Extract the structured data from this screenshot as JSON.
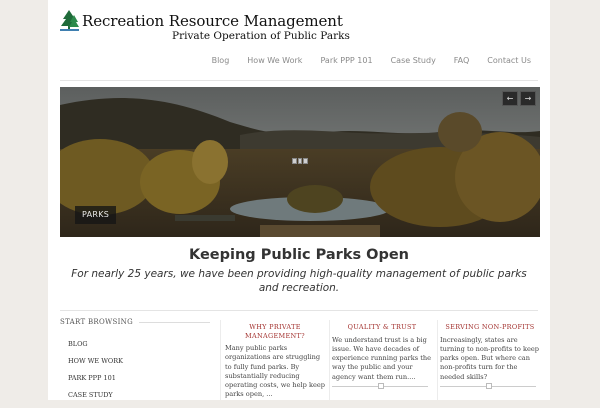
{
  "logo": {
    "title": "Recreation Resource Management",
    "subtitle": "Private Operation of Public Parks",
    "icon": "pine-tree-icon"
  },
  "nav": {
    "items": [
      "Blog",
      "How We Work",
      "Park PPP 101",
      "Case Study",
      "FAQ",
      "Contact Us"
    ]
  },
  "hero": {
    "caption": "PARKS",
    "prev": "←",
    "next": "→"
  },
  "tagline": {
    "title": "Keeping Public Parks Open",
    "text": "For nearly 25 years, we have been providing high-quality management of public parks and recreation."
  },
  "sidebar": {
    "heading": "START BROWSING",
    "items": [
      "BLOG",
      "HOW WE WORK",
      "PARK PPP 101",
      "CASE STUDY"
    ]
  },
  "columns": [
    {
      "title": "WHY PRIVATE MANAGEMENT?",
      "text": "Many public parks organizations are struggling to fully fund parks.  By  substantially reducing operating costs, we help keep parks open, ..."
    },
    {
      "title": "QUALITY & TRUST",
      "text": "We understand trust is a big issue.  We have decades of experience running parks the way the public and your agency want them run...."
    },
    {
      "title": "SERVING NON-PROFITS",
      "text": "Increasingly, states are turning to non-profits to keep parks open.  But where can non-profits turn for the needed skills?"
    }
  ],
  "colors": {
    "accent": "#a3322f",
    "nav_text": "#8a8a8a",
    "page_bg": "#efece8"
  }
}
